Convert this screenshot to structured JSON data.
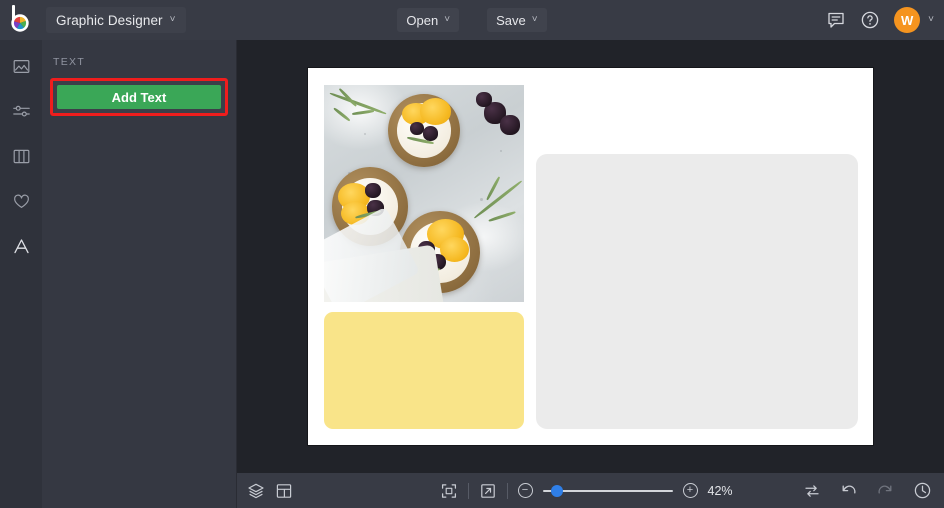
{
  "app": {
    "brand_icon": "befunky-logo-icon",
    "title": "Graphic Designer",
    "title_chevron": "˅"
  },
  "topbar": {
    "open_label": "Open",
    "save_label": "Save",
    "open_chevron": "˅",
    "save_chevron": "˅",
    "feedback_icon": "speech-bubble-icon",
    "help_icon": "question-mark-icon",
    "avatar_initial": "W",
    "avatar_chevron": "˅",
    "avatar_color": "#f5941f"
  },
  "rail": {
    "items": [
      {
        "icon": "image-icon",
        "name": "image",
        "active": false
      },
      {
        "icon": "sliders-icon",
        "name": "adjust",
        "active": false
      },
      {
        "icon": "columns-icon",
        "name": "layouts",
        "active": false
      },
      {
        "icon": "heart-icon",
        "name": "favorites",
        "active": false
      },
      {
        "icon": "letter-a-icon",
        "name": "text",
        "active": true
      }
    ]
  },
  "panel": {
    "section_label": "TEXT",
    "add_text_label": "Add Text",
    "add_text_color": "#3aa757",
    "highlight_color": "#ef1d1d"
  },
  "canvas": {
    "cells": [
      {
        "name": "photo-cell",
        "type": "image",
        "alt": "fruit tarts with orange slices and blackberries"
      },
      {
        "name": "yellow-cell",
        "type": "color",
        "color": "#f9e489"
      },
      {
        "name": "gray-cell",
        "type": "placeholder",
        "color": "#ebebeb"
      }
    ]
  },
  "bottombar": {
    "layers_icon": "layers-icon",
    "collage_icon": "collage-grid-icon",
    "fit_icon": "fit-to-screen-icon",
    "expand_icon": "expand-arrow-icon",
    "zoom_out_icon": "minus-icon",
    "zoom_out_glyph": "−",
    "zoom_in_icon": "plus-icon",
    "zoom_in_glyph": "+",
    "zoom_value": "42%",
    "swap_icon": "swap-arrows-icon",
    "undo_icon": "undo-arrow-icon",
    "redo_icon": "redo-arrow-icon",
    "history_icon": "clock-history-icon",
    "slider_accent": "#2f7fe8"
  }
}
